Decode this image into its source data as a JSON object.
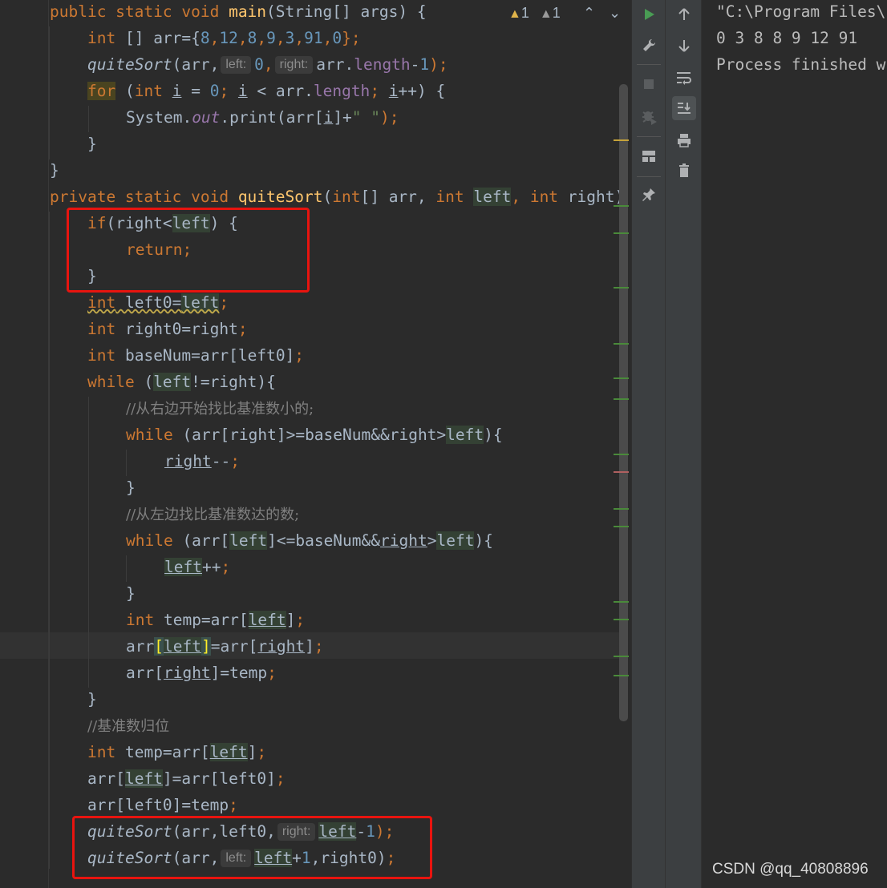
{
  "editor": {
    "lines": {
      "l1": {
        "kw": "public static void",
        "fn": "main",
        "rest": "(String[] args) {"
      },
      "l2": {
        "kw": "int",
        "a": " [] arr={",
        "n1": "8",
        "c1": ",",
        "n2": "12",
        "c2": ",",
        "n3": "8",
        "c3": ",",
        "n4": "9",
        "c4": ",",
        "n5": "3",
        "c5": ",",
        "n6": "91",
        "c6": ",",
        "n7": "0",
        "end": "};"
      },
      "l3": {
        "call": "quiteSort",
        "a": "(arr,",
        "hint1": "left:",
        "n0": "0",
        "c1": ",",
        "hint2": "right:",
        "b": "arr.",
        "f": "length",
        "op": "-",
        "n1": "1",
        "end": ");"
      },
      "l4": {
        "kw": "for",
        "a": " (",
        "kw2": "int",
        "b": " ",
        "i1": "i",
        "c": " = ",
        "n0": "0",
        "d": "; ",
        "i2": "i",
        "e": " < arr.",
        "f": "length",
        "g": "; ",
        "i3": "i",
        "h": "++) {"
      },
      "l5": {
        "a": "System.",
        "out": "out",
        "b": ".print(arr[",
        "i": "i",
        "c": "]+",
        "s": "\" \"",
        "end": ");"
      },
      "l6": {
        "t": "}"
      },
      "l7": {
        "t": "}"
      },
      "l8": {
        "kw": "private static void",
        "fn": "quiteSort",
        "a": "(",
        "kw2": "int",
        "b": "[] arr, ",
        "kw3": "int",
        "sp": " ",
        "v1": "left",
        "c": ", ",
        "kw4": "int",
        "d": " right)"
      },
      "l9": {
        "kw": "if",
        "a": "(right<",
        "v": "left",
        "b": ") {"
      },
      "l10": {
        "kw": "return",
        "end": ";"
      },
      "l11": {
        "t": "}"
      },
      "l12": {
        "kw": "int",
        "a": " left0=",
        "v": "left",
        "end": ";"
      },
      "l13": {
        "kw": "int",
        "a": " right0=right",
        "end": ";"
      },
      "l14": {
        "kw": "int",
        "a": " baseNum=arr[left0]",
        "end": ";"
      },
      "l15": {
        "kw": "while",
        "a": " (",
        "v": "left",
        "b": "!=right){"
      },
      "l16": {
        "t": "//从右边开始找比基准数小的;"
      },
      "l17": {
        "kw": "while",
        "a": " (arr[right]>=baseNum&&right>",
        "v": "left",
        "b": "){"
      },
      "l18": {
        "v": "right",
        "op": "--",
        "end": ";"
      },
      "l19": {
        "t": "}"
      },
      "l20": {
        "t": "//从左边找比基准数达的数;"
      },
      "l21": {
        "kw": "while",
        "a": " (arr[",
        "v1": "left",
        "b": "]<=baseNum&&",
        "v2": "right",
        "c": ">",
        "v3": "left",
        "d": "){"
      },
      "l22": {
        "v": "left",
        "op": "++",
        "end": ";"
      },
      "l23": {
        "t": "}"
      },
      "l24": {
        "kw": "int",
        "a": " temp=arr[",
        "v": "left",
        "b": "]",
        "end": ";"
      },
      "l25": {
        "a": "arr",
        "lb": "[",
        "v1": "left",
        "rb": "]",
        "b": "=arr[",
        "v2": "right",
        "c": "]",
        "end": ";"
      },
      "l26": {
        "a": "arr[",
        "v": "right",
        "b": "]=temp",
        "end": ";"
      },
      "l27": {
        "t": "}"
      },
      "l28": {
        "t": "//基准数归位"
      },
      "l29": {
        "kw": "int",
        "a": " temp=arr[",
        "v": "left",
        "b": "]",
        "end": ";"
      },
      "l30": {
        "a": "arr[",
        "v": "left",
        "b": "]=arr[left0]",
        "end": ";"
      },
      "l31": {
        "a": "arr[left0]=temp",
        "end": ";"
      },
      "l32": {
        "call": "quiteSort",
        "a": "(arr,left0,",
        "hint": "right:",
        "v": "left",
        "op": "-",
        "n": "1",
        "end": ");"
      },
      "l33": {
        "call": "quiteSort",
        "a": "(arr,",
        "hint": "left:",
        "v": "left",
        "op": "+",
        "n": "1",
        "b": ",right0)",
        "end": ";"
      }
    },
    "inspections": {
      "warnings_yellow": "1",
      "warnings_gray": "1",
      "warn_icon": "warning-triangle-icon",
      "up_icon": "chevron-up-icon",
      "down_icon": "chevron-down-icon"
    },
    "colors": {
      "highlight_box": "#e8140f",
      "keyword": "#cc7832",
      "method": "#ffc66d",
      "number": "#6897bb"
    }
  },
  "run_toolbar": {
    "icons": [
      "rerun-icon",
      "wrench-icon",
      "stop-icon",
      "debug-icon",
      "layout-icon",
      "pin-icon",
      "up-arrow-icon",
      "down-arrow-icon",
      "soft-wrap-icon",
      "scroll-to-end-icon",
      "print-icon",
      "trash-icon"
    ]
  },
  "console": {
    "lines": [
      "\"C:\\Program Files\\",
      "0 3 8 8 9 12 91",
      "Process finished w"
    ]
  },
  "watermark": "CSDN @qq_40808896"
}
